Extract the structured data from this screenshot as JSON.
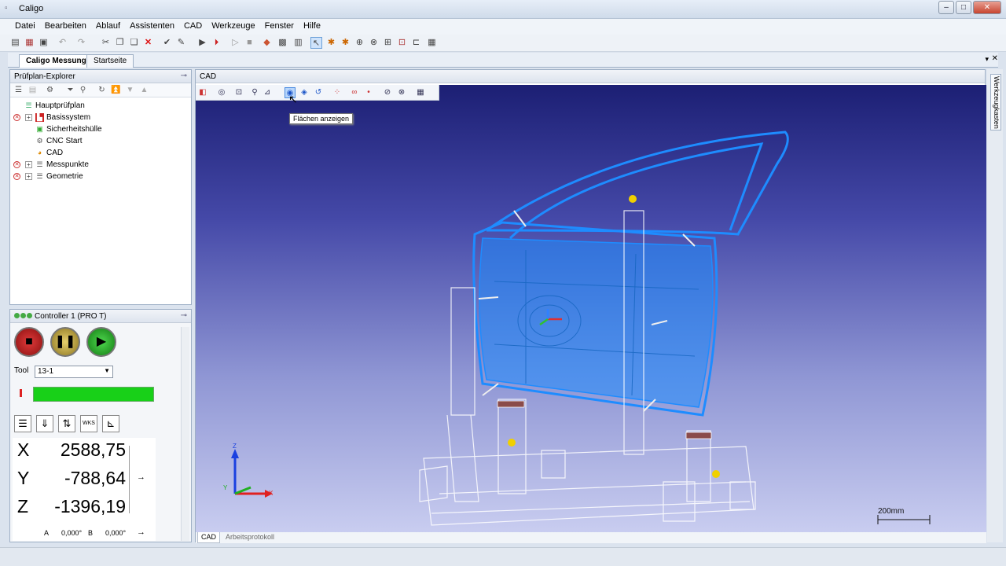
{
  "window": {
    "title": "Caligo"
  },
  "menu": [
    "Datei",
    "Bearbeiten",
    "Ablauf",
    "Assistenten",
    "CAD",
    "Werkzeuge",
    "Fenster",
    "Hilfe"
  ],
  "doc_tabs": [
    {
      "label": "Caligo Messung",
      "active": true
    },
    {
      "label": "Startseite",
      "active": false
    }
  ],
  "explorer": {
    "title": "Prüfplan-Explorer",
    "items": [
      {
        "label": "Hauptprüfplan",
        "level": 0,
        "error": false,
        "expandable": false,
        "icon": "plan-icon"
      },
      {
        "label": "Basissystem",
        "level": 1,
        "error": true,
        "expandable": true,
        "icon": "base-system-icon"
      },
      {
        "label": "Sicherheitshülle",
        "level": 1,
        "error": false,
        "expandable": false,
        "icon": "safety-hull-icon"
      },
      {
        "label": "CNC Start",
        "level": 1,
        "error": false,
        "expandable": false,
        "icon": "gear-icon"
      },
      {
        "label": "CAD",
        "level": 1,
        "error": false,
        "expandable": false,
        "icon": "cad-icon"
      },
      {
        "label": "Messpunkte",
        "level": 1,
        "error": true,
        "expandable": true,
        "icon": "list-icon"
      },
      {
        "label": "Geometrie",
        "level": 1,
        "error": true,
        "expandable": true,
        "icon": "list-icon"
      }
    ]
  },
  "controller": {
    "title": "Controller 1 (PRO T)",
    "tool_label": "Tool",
    "tool_value": "13-1",
    "coords": {
      "X": "2588,75",
      "Y": "-788,64",
      "Z": "-1396,19"
    },
    "angles": {
      "A_label": "A",
      "A": "0,000°",
      "B_label": "B",
      "B": "0,000°"
    },
    "wks_label": "WKS"
  },
  "cad": {
    "panel_title": "CAD",
    "tooltip": "Flächen anzeigen",
    "scale_label": "200mm",
    "axis": {
      "x": "X",
      "y": "Y",
      "z": "Z"
    },
    "bottom_tabs": [
      "CAD",
      "Arbeitsprotokoll"
    ]
  },
  "right_strip": {
    "label": "Werkzeugkasten"
  },
  "colors": {
    "wire": "#1e8cff",
    "progress": "#18d018",
    "bg_top": "#1c1f74",
    "bg_bottom": "#c9cdf0"
  }
}
